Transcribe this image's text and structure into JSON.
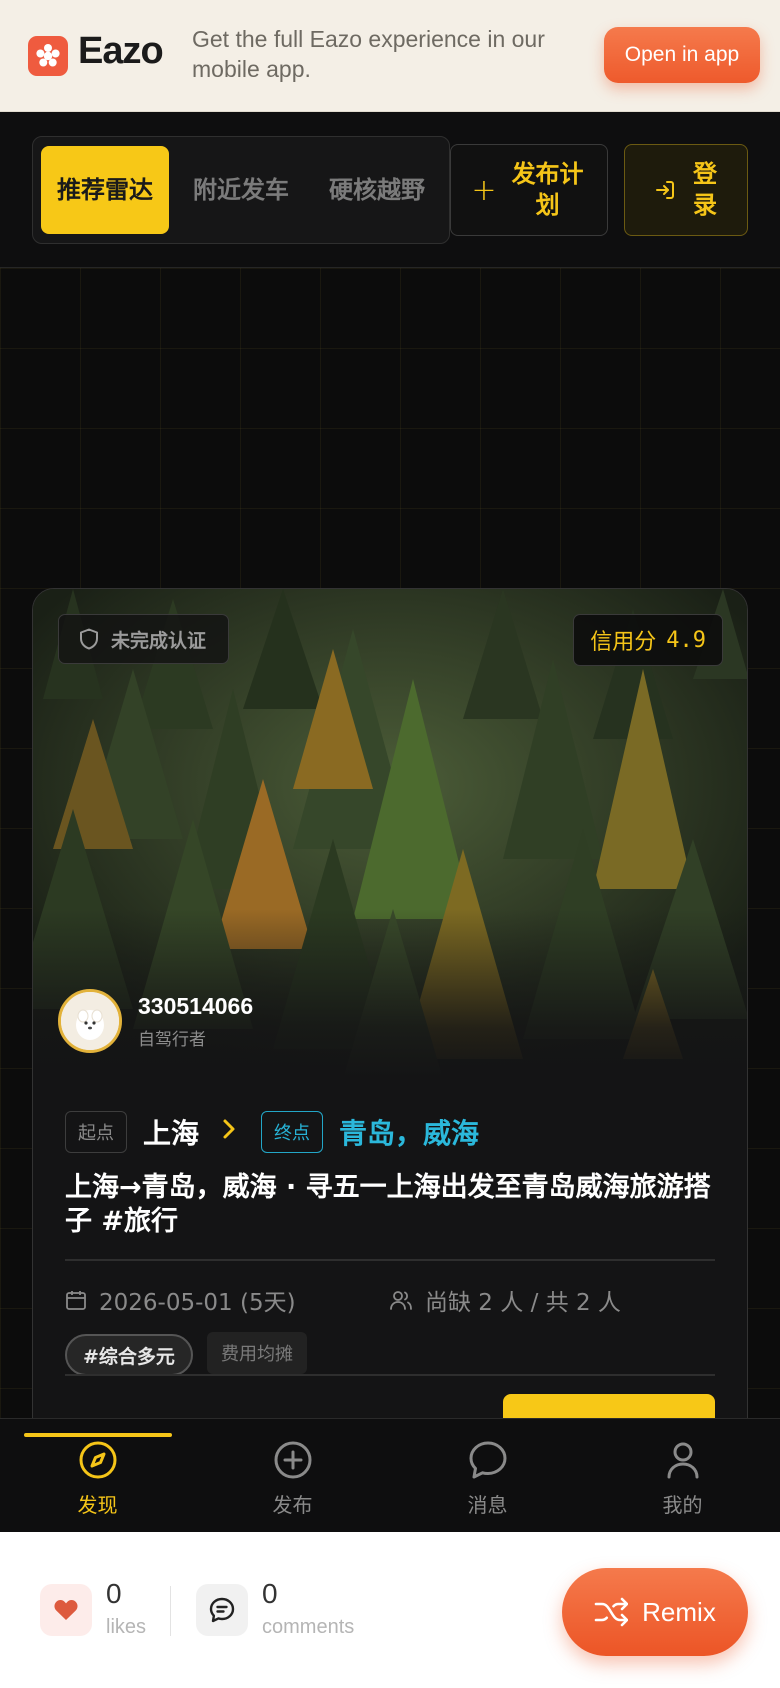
{
  "banner": {
    "brand": "Eazo",
    "message": "Get the full Eazo experience in our mobile app.",
    "open_label": "Open in app"
  },
  "header": {
    "tabs": [
      {
        "label": "推荐雷达",
        "active": true
      },
      {
        "label": "附近发车",
        "active": false
      },
      {
        "label": "硬核越野",
        "active": false
      }
    ],
    "plan_label": "发布计划",
    "plan_icon": "plus-icon",
    "login_label": "登录",
    "login_icon": "login-icon"
  },
  "card": {
    "verify_label": "未完成认证",
    "credit_label": "信用分",
    "credit_value": "4.9",
    "username": "330514066",
    "user_role": "自驾行者",
    "start_tag": "起点",
    "start_city": "上海",
    "end_tag": "终点",
    "end_city": "青岛，威海",
    "title": "上海→青岛，威海 · 寻五一上海出发至青岛威海旅游搭子 #旅行",
    "date": "2026-05-01 (5天)",
    "people": "尚缺 2 人 / 共 2 人",
    "chip_tag": "#综合多元",
    "chip_cost": "费用均摊"
  },
  "tabbar": {
    "items": [
      {
        "label": "发现",
        "icon": "compass-icon",
        "active": true
      },
      {
        "label": "发布",
        "icon": "plus-circle-icon",
        "active": false
      },
      {
        "label": "消息",
        "icon": "chat-bubble-icon",
        "active": false
      },
      {
        "label": "我的",
        "icon": "user-icon",
        "active": false
      }
    ]
  },
  "social": {
    "likes_count": "0",
    "likes_label": "likes",
    "comments_count": "0",
    "comments_label": "comments",
    "remix_label": "Remix"
  },
  "colors": {
    "accent": "#f7c817",
    "brand": "#ef5b3f",
    "teal": "#2bb8db",
    "background": "#0d0d0e"
  }
}
